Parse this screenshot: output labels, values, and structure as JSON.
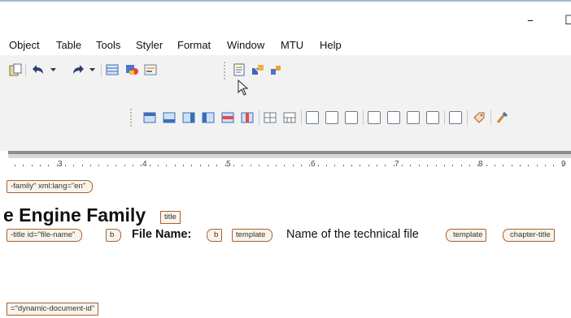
{
  "window": {
    "minimize_glyph": "–",
    "maximize_glyph": "☐"
  },
  "menu": [
    "Object",
    "Table",
    "Tools",
    "Styler",
    "Format",
    "Window",
    "MTU",
    "Help"
  ],
  "toolbar": {
    "icons": [
      "paste-icon",
      "undo-icon",
      "redo-icon",
      "table-icon",
      "tag-icon",
      "list-icon",
      "document-icon",
      "transform-icon",
      "transform-link-icon"
    ],
    "format_icons": [
      "insert-row-above-icon",
      "insert-row-below-icon",
      "insert-column-left-icon",
      "insert-column-right-icon",
      "delete-row-icon",
      "delete-column-icon",
      "split-cell-icon",
      "merge-cell-icon",
      "align-top-icon",
      "align-middle-icon",
      "align-bottom-icon",
      "align-left-icon",
      "align-center-icon",
      "align-right-icon",
      "justify-icon",
      "indent-icon",
      "tag-edit-icon",
      "format-painter-icon"
    ]
  },
  "ruler": {
    "numbers": [
      "3",
      "4",
      "5",
      "6",
      "7",
      "8",
      "9"
    ]
  },
  "document": {
    "tag_family": "-family\" xml:lang=\"en\"",
    "heading": "e Engine Family",
    "tag_title": "title",
    "tag_title_id": "-title id=\"file-name\"",
    "tag_b_open": "b",
    "file_name_label": "File Name:",
    "tag_b_close": "b",
    "tag_template_open": "template",
    "file_name_value": "Name of the technical file",
    "tag_template_close": "template",
    "tag_chapter_title": "chapter-title",
    "tag_dynamic_id": "=\"dynamic-document-id\""
  }
}
